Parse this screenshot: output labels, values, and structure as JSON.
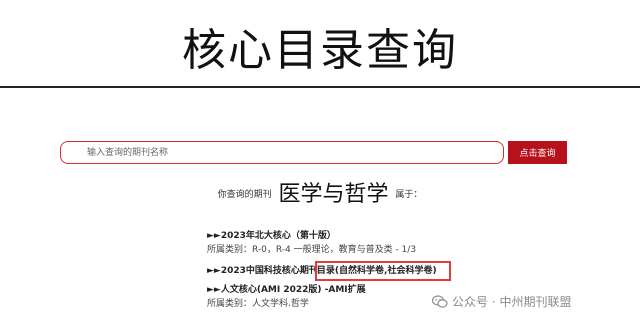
{
  "page": {
    "title": "核心目录查询"
  },
  "search": {
    "placeholder": "输入查询的期刊名称",
    "button_label": "点击查询"
  },
  "query": {
    "prefix": "你查询的期刊",
    "journal_name": "医学与哲学",
    "suffix": "属于："
  },
  "results": [
    {
      "title": "►►2023年北大核心（第十版）",
      "category": "所属类别：R-0，R-4 一般理论，教育与普及类 - 1/3"
    },
    {
      "title_main": "►►2023中国科技核心期刊",
      "title_highlight": "目录(自然科学卷,社会科学卷)"
    },
    {
      "title": "►►人文核心(AMI 2022版) -AMI扩展",
      "category": "所属类别：人文学科.哲学"
    }
  ],
  "watermark": {
    "text": "公众号 · 中州期刊联盟",
    "icon": "wechat-icon"
  },
  "colors": {
    "accent": "#b5121b",
    "highlight_border": "#e23b3b"
  }
}
